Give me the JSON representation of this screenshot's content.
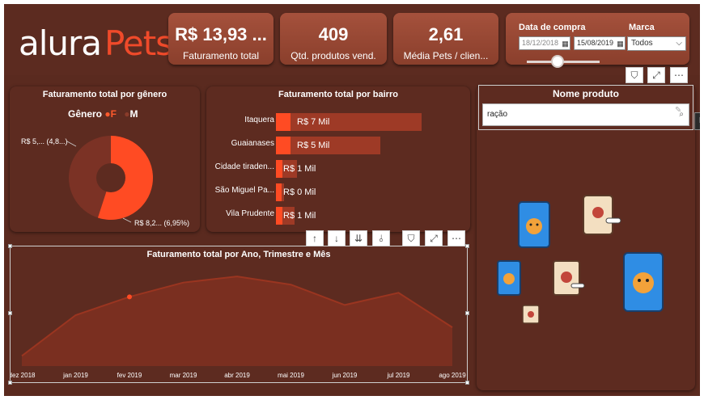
{
  "brand": {
    "logo_text_1": "alura",
    "logo_text_2": "Pets"
  },
  "kpis": [
    {
      "value": "R$ 13,93 ...",
      "label": "Faturamento total"
    },
    {
      "value": "409",
      "label": "Qtd. produtos vend."
    },
    {
      "value": "2,61",
      "label": "Média Pets / clien..."
    }
  ],
  "filters": {
    "date_label": "Data de compra",
    "date_start": "18/12/2018",
    "date_end": "15/08/2019",
    "brand_label": "Marca",
    "brand_value": "Todos",
    "date_range_position": 0.55
  },
  "visual_toolbar": {
    "filter_icon": "filter-icon",
    "focus_icon": "focus-mode-icon",
    "more_icon": "more-options-icon"
  },
  "donut": {
    "title": "Faturamento total por gênero",
    "legend_title": "Gênero",
    "legend_items": [
      "F",
      "M"
    ],
    "label_top": "R$ 5,... (4,8...)",
    "label_bottom": "R$ 8,2... (6,95%)",
    "colors": {
      "F": "#ff4b23",
      "M": "#8a3b2a"
    }
  },
  "bars": {
    "title": "Faturamento total por bairro",
    "items": [
      {
        "label": "Itaquera",
        "value_label": "R$ 7 Mil",
        "value": 7.0
      },
      {
        "label": "Guaianases",
        "value_label": "R$ 5 Mil",
        "value": 5.0
      },
      {
        "label": "Cidade tiraden...",
        "value_label": "R$ 1 Mil",
        "value": 1.0
      },
      {
        "label": "São Miguel Pa...",
        "value_label": "R$ 0 Mil",
        "value": 0.4
      },
      {
        "label": "Vila Prudente",
        "value_label": "R$ 1 Mil",
        "value": 0.9
      }
    ]
  },
  "chart_data": {
    "type": "area",
    "title": "Faturamento total por Ano, Trimestre e Mês",
    "categories": [
      "dez 2018",
      "jan 2019",
      "fev 2019",
      "mar 2019",
      "abr 2019",
      "mai 2019",
      "jun 2019",
      "jul 2019",
      "ago 2019"
    ],
    "values": [
      0.1,
      0.5,
      0.68,
      0.82,
      0.88,
      0.8,
      0.6,
      0.72,
      0.38
    ],
    "ylim": [
      0,
      1
    ],
    "color": "#7a2f20",
    "highlight_index": 2
  },
  "drill_toolbar": {
    "up": "drill-up-icon",
    "down": "drill-down-icon",
    "next": "next-level-icon",
    "expand": "expand-all-icon"
  },
  "product_panel": {
    "title": "Nome produto",
    "search_value": "ração",
    "tooltip_tab": "N"
  }
}
